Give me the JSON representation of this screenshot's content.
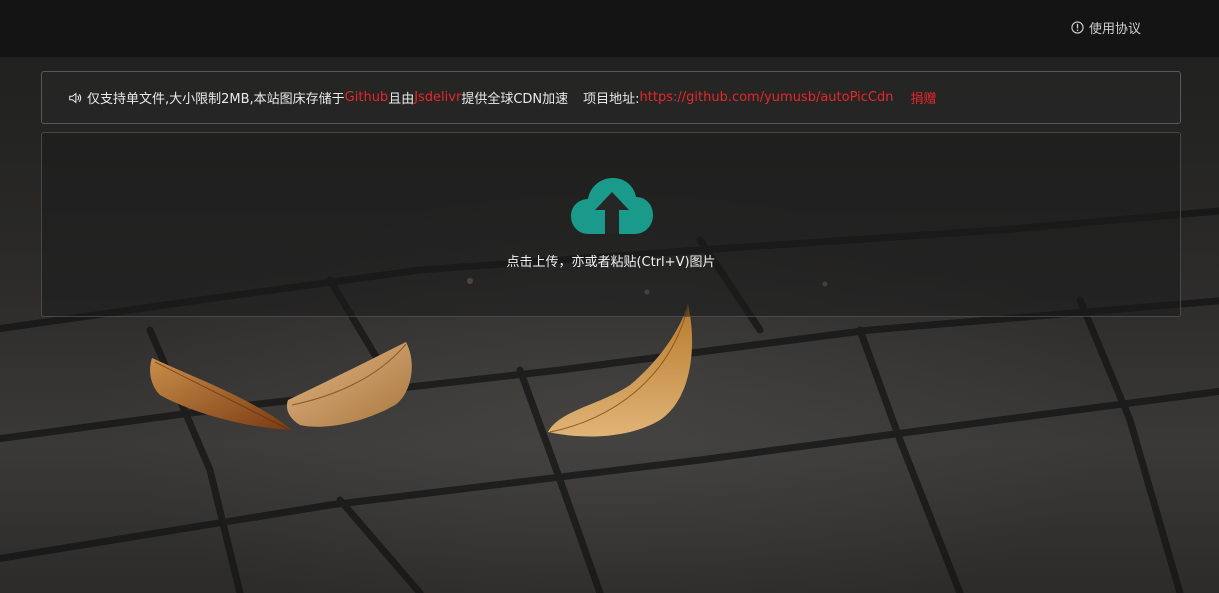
{
  "header": {
    "terms_label": "使用协议",
    "terms_icon": "info-icon"
  },
  "notice": {
    "icon": "speaker-icon",
    "text_prefix": "仅支持单文件,大小限制2MB,本站图床存储于",
    "github_link": "Github",
    "text_mid": "且由",
    "jsdelivr_link": "Jsdelivr",
    "text_suffix": "提供全球CDN加速",
    "project_label": "项目地址:",
    "project_url": "https://github.com/yumusb/autoPicCdn",
    "donate_link": "捐赠"
  },
  "upload": {
    "icon": "cloud-upload-icon",
    "hint": "点击上传，亦或者粘贴(Ctrl+V)图片",
    "icon_color": "#1a9a8b"
  },
  "colors": {
    "link_red": "#e8262b",
    "accent_teal": "#1a9a8b"
  }
}
